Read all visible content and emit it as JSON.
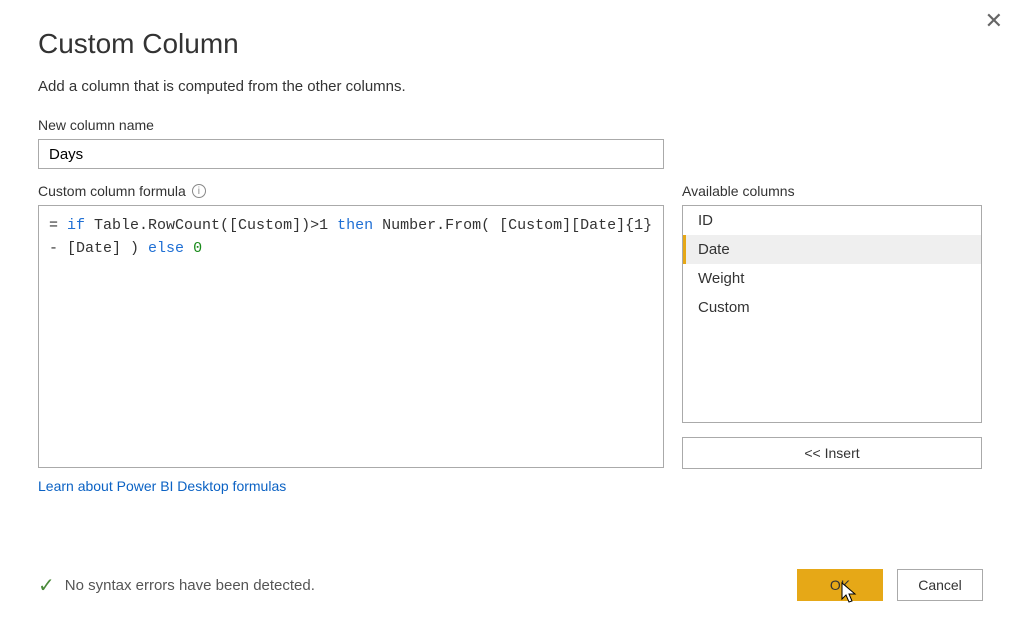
{
  "dialog": {
    "title": "Custom Column",
    "subtitle": "Add a column that is computed from the other columns.",
    "close_glyph": "✕"
  },
  "name_field": {
    "label": "New column name",
    "value": "Days"
  },
  "formula": {
    "label": "Custom column formula",
    "prefix": "= ",
    "kw_if": "if",
    "part1": " Table.RowCount([Custom])>1 ",
    "kw_then": "then",
    "part2": " Number.From( [Custom][Date]{1} - [Date] ) ",
    "kw_else": "else",
    "space": " ",
    "num_zero": "0"
  },
  "learn_link": "Learn about Power BI Desktop formulas",
  "available": {
    "label": "Available columns",
    "items": [
      "ID",
      "Date",
      "Weight",
      "Custom"
    ],
    "selected_index": 1,
    "insert_label": "<< Insert"
  },
  "status": {
    "text": "No syntax errors have been detected."
  },
  "buttons": {
    "ok": "OK",
    "cancel": "Cancel"
  }
}
